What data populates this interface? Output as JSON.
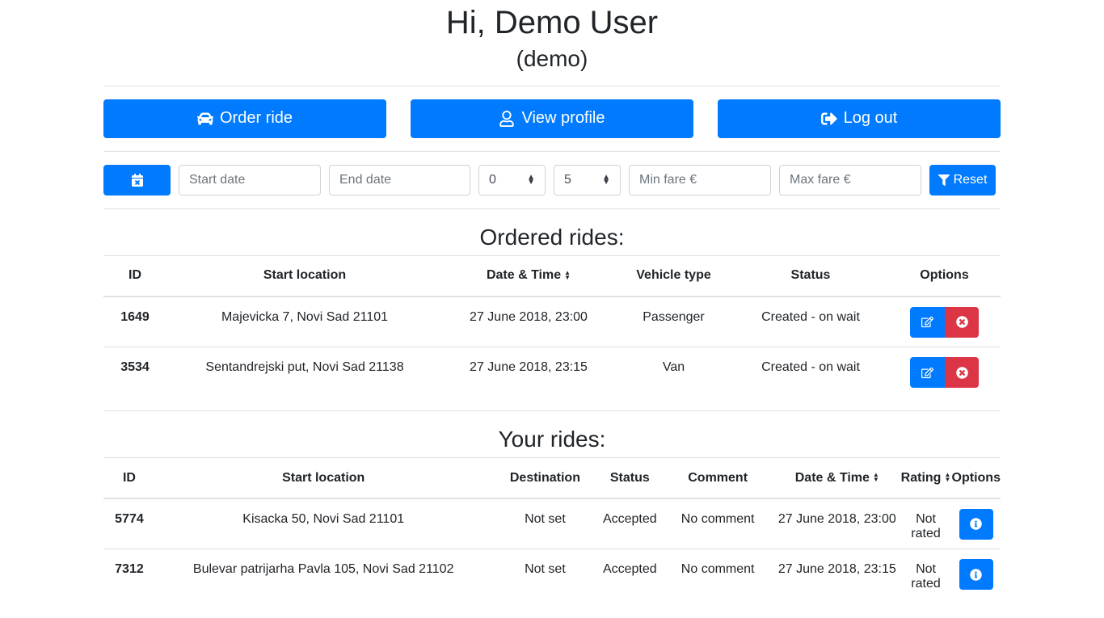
{
  "header": {
    "greeting": "Hi, Demo User",
    "username": "(demo)"
  },
  "actions": {
    "order_ride": "Order ride",
    "view_profile": "View profile",
    "log_out": "Log out"
  },
  "filters": {
    "start_date_placeholder": "Start date",
    "end_date_placeholder": "End date",
    "select_min": "0",
    "select_max": "5",
    "min_fare_placeholder": "Min fare €",
    "max_fare_placeholder": "Max fare €",
    "reset_label": "Reset"
  },
  "ordered": {
    "title": "Ordered rides:",
    "headers": [
      "ID",
      "Start location",
      "Date & Time",
      "Vehicle type",
      "Status",
      "Options"
    ],
    "rows": [
      {
        "id": "1649",
        "start": "Majevicka 7, Novi Sad 21101",
        "datetime": "27 June 2018, 23:00",
        "vehicle": "Passenger",
        "status": "Created - on wait"
      },
      {
        "id": "3534",
        "start": "Sentandrejski put, Novi Sad 21138",
        "datetime": "27 June 2018, 23:15",
        "vehicle": "Van",
        "status": "Created - on wait"
      }
    ]
  },
  "yours": {
    "title": "Your rides:",
    "headers": [
      "ID",
      "Start location",
      "Destination",
      "Status",
      "Comment",
      "Date & Time",
      "Rating",
      "Options"
    ],
    "rows": [
      {
        "id": "5774",
        "start": "Kisacka 50, Novi Sad 21101",
        "destination": "Not set",
        "status": "Accepted",
        "comment": "No comment",
        "datetime": "27 June 2018, 23:00",
        "rating": "Not rated"
      },
      {
        "id": "7312",
        "start": "Bulevar patrijarha Pavla 105, Novi Sad 21102",
        "destination": "Not set",
        "status": "Accepted",
        "comment": "No comment",
        "datetime": "27 June 2018, 23:15",
        "rating": "Not rated"
      }
    ]
  },
  "icons": {
    "order": "car-icon",
    "profile": "user-icon",
    "logout": "sign-out-icon",
    "calendar": "calendar-times-icon",
    "filter": "filter-icon",
    "edit": "edit-icon",
    "delete": "times-circle-icon",
    "info": "info-circle-icon",
    "sort": "sort-icon"
  },
  "colors": {
    "primary": "#007bff",
    "danger": "#dc3545"
  }
}
